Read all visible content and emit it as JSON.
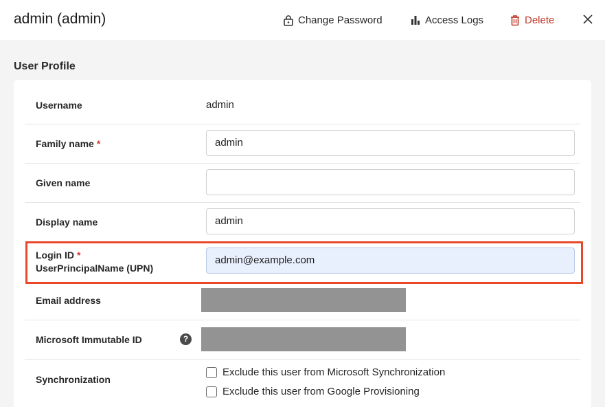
{
  "header": {
    "title": "admin (admin)",
    "change_password": "Change Password",
    "access_logs": "Access Logs",
    "delete": "Delete"
  },
  "section": {
    "title": "User Profile"
  },
  "fields": {
    "username": {
      "label": "Username",
      "value": "admin"
    },
    "family_name": {
      "label": "Family name",
      "required": "*",
      "value": "admin"
    },
    "given_name": {
      "label": "Given name",
      "value": ""
    },
    "display_name": {
      "label": "Display name",
      "value": "admin"
    },
    "login_id": {
      "label": "Login ID",
      "required": "*",
      "sublabel": "UserPrincipalName (UPN)",
      "value": "admin@example.com"
    },
    "email": {
      "label": "Email address"
    },
    "immutable_id": {
      "label": "Microsoft Immutable ID",
      "help": "?"
    },
    "sync": {
      "label": "Synchronization",
      "options": [
        "Exclude this user from Microsoft Synchronization",
        "Exclude this user from Google Provisioning"
      ]
    }
  },
  "colors": {
    "highlight": "#e8472a",
    "delete": "#c0392b",
    "required": "#d0342c",
    "focused_input": "#e8effd"
  }
}
